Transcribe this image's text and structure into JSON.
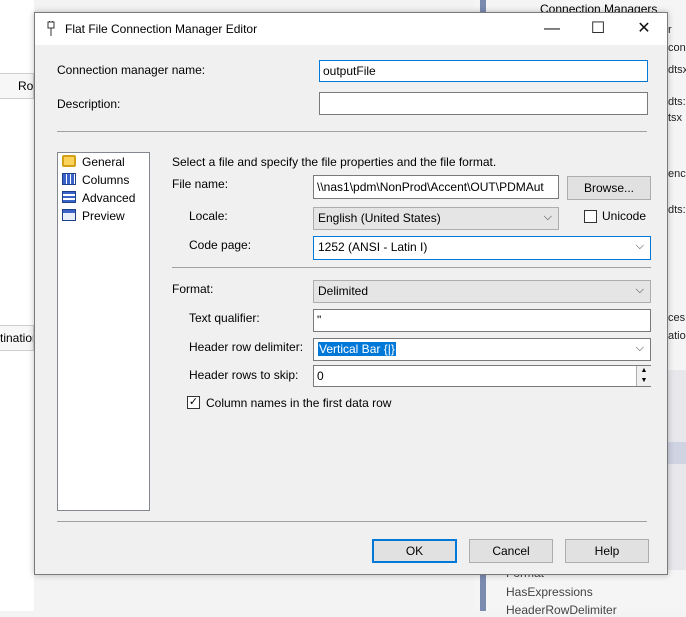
{
  "background": {
    "left_items": [
      "Ro",
      "tination"
    ],
    "right_header": "Connection Managers",
    "right_texts": [
      "r",
      "conn",
      "dtsx",
      "dts:",
      "tsx",
      "ence",
      "dts:",
      "ces",
      "ation"
    ],
    "props": [
      "Format",
      "HasExpressions",
      "HeaderRowDelimiter"
    ]
  },
  "dialog": {
    "title": "Flat File Connection Manager Editor",
    "window_buttons": {
      "minimize": "—",
      "maximize": "☐",
      "close": "✕"
    },
    "conn_name_label": "Connection manager name:",
    "conn_name_value": "outputFile",
    "description_label": "Description:",
    "description_value": "",
    "nav_items": [
      "General",
      "Columns",
      "Advanced",
      "Preview"
    ],
    "instructions": "Select a file and specify the file properties and the file format.",
    "file_name_label": "File name:",
    "file_name_value": "\\\\nas1\\pdm\\NonProd\\Accent\\OUT\\PDMAut",
    "browse_label": "Browse...",
    "locale_label": "Locale:",
    "locale_value": "English (United States)",
    "unicode_label": "Unicode",
    "unicode_checked": false,
    "code_page_label": "Code page:",
    "code_page_value": "1252  (ANSI - Latin I)",
    "format_label": "Format:",
    "format_value": "Delimited",
    "text_qualifier_label": "Text qualifier:",
    "text_qualifier_value": "\"",
    "header_row_delim_label": "Header row delimiter:",
    "header_row_delim_value": "Vertical Bar {|}",
    "header_rows_skip_label": "Header rows to skip:",
    "header_rows_skip_value": "0",
    "col_names_label": "Column names in the first data row",
    "col_names_checked": true,
    "ok_label": "OK",
    "cancel_label": "Cancel",
    "help_label": "Help"
  }
}
